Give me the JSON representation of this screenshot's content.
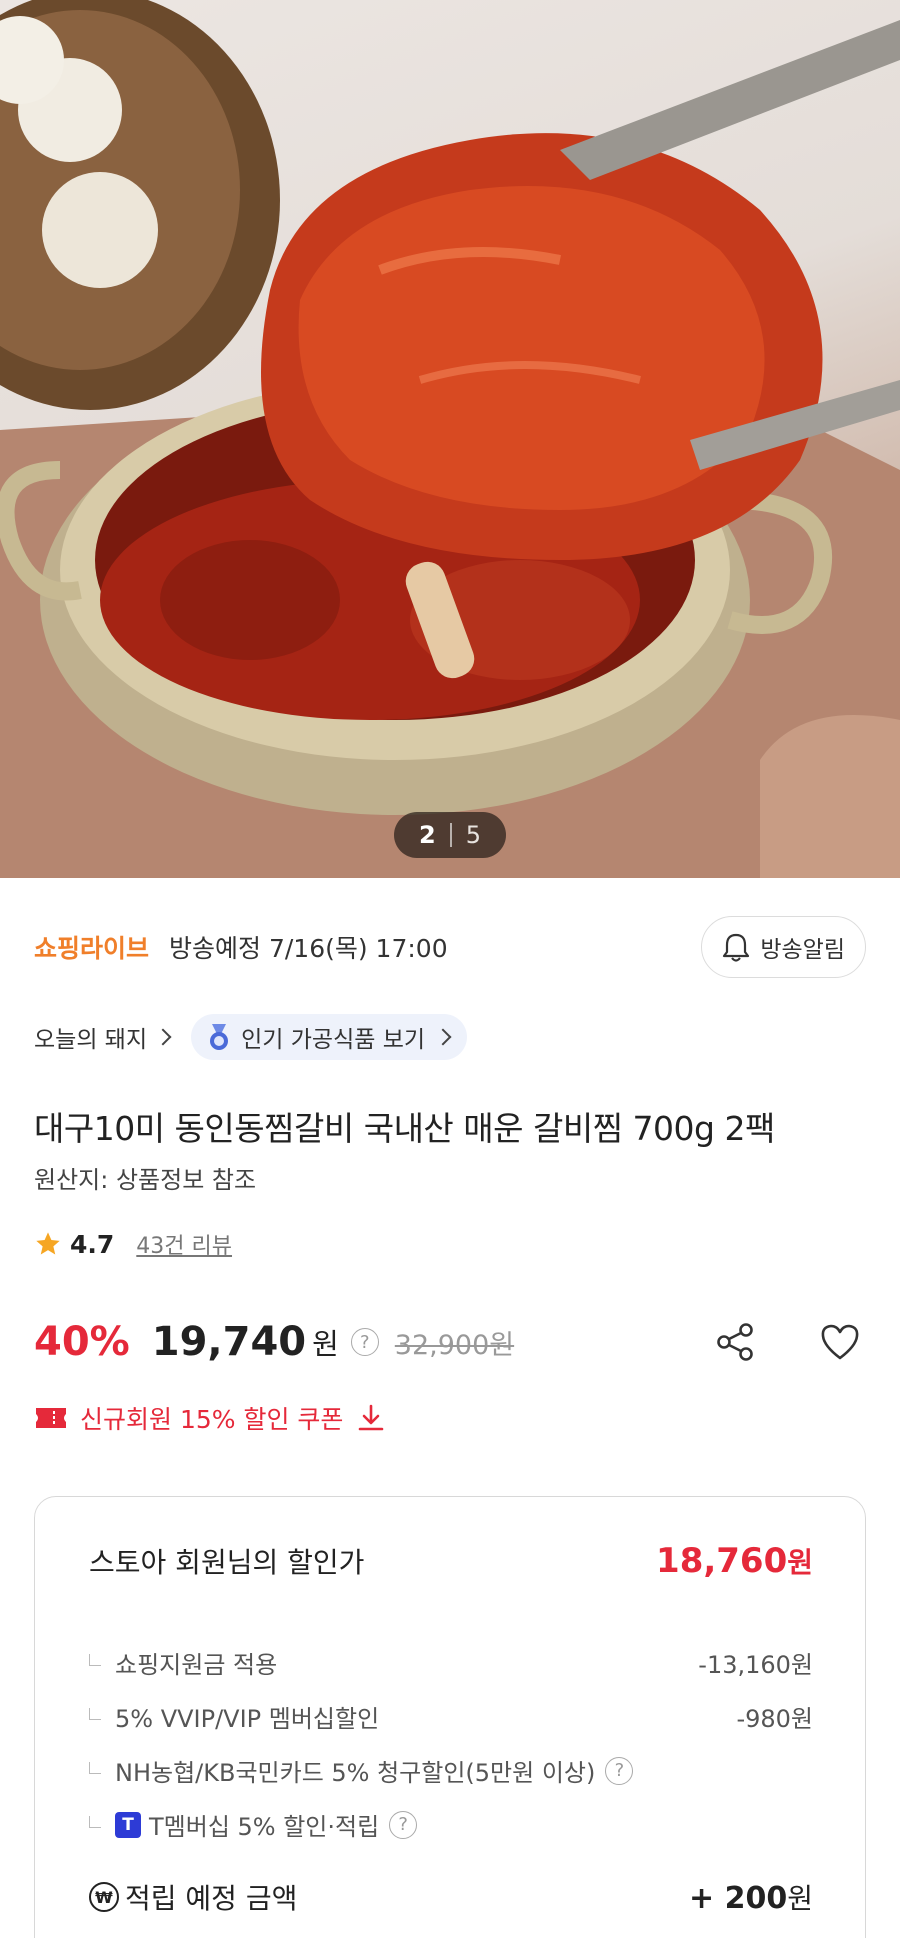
{
  "hero": {
    "image_alt": "product-photo",
    "pager": {
      "current": "2",
      "total": "5"
    }
  },
  "live": {
    "brand": "쇼핑라이브",
    "schedule": "방송예정 7/16(목) 17:00",
    "alarm_label": "방송알림"
  },
  "tags": {
    "store": "오늘의 돼지",
    "category_chip": "인기 가공식품 보기"
  },
  "product": {
    "title": "대구10미 동인동찜갈비 국내산 매운 갈비찜 700g 2팩",
    "origin": "원산지: 상품정보 참조",
    "rating": "4.7",
    "reviews": "43건 리뷰"
  },
  "price": {
    "discount": "40%",
    "price": "19,740",
    "won": "원",
    "help": "?",
    "original": "32,900원",
    "coupon": "신규회원 15% 할인 쿠폰"
  },
  "benefits": {
    "title": "스토아 회원님의 할인가",
    "price": "18,760",
    "won": "원",
    "lines": [
      {
        "label": "쇼핑지원금 적용",
        "value": "-13,160원"
      },
      {
        "label": "5% VVIP/VIP 멤버십할인",
        "value": "-980원"
      },
      {
        "label": "NH농협/KB국민카드 5% 청구할인(5만원 이상)",
        "value": ""
      },
      {
        "label": "T멤버십 5% 할인·적립",
        "value": "",
        "badge": "T"
      }
    ],
    "reward_icon": "₩",
    "reward_label": "적립 예정 금액",
    "reward_value": "+ 200",
    "reward_won": "원"
  },
  "colors": {
    "accent_red": "#e5293a",
    "live_orange": "#f07f2a",
    "t_badge": "#2d3bd6"
  }
}
